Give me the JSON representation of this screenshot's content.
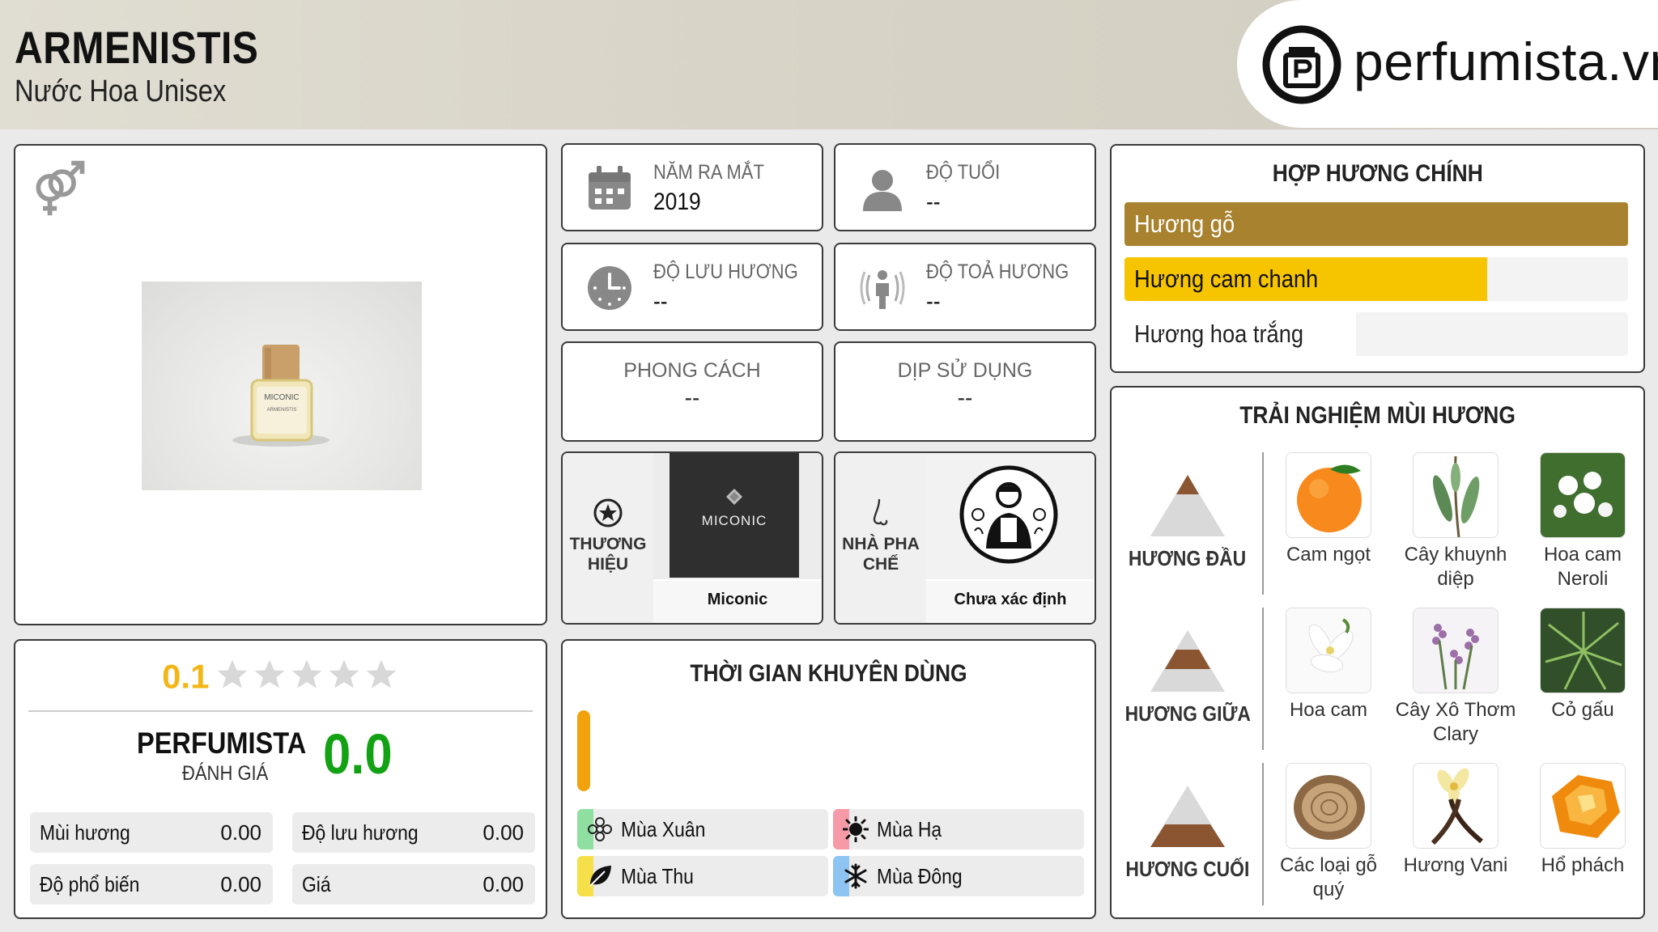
{
  "header": {
    "title": "ARMENISTIS",
    "subtitle": "Nước Hoa Unisex",
    "logo_text": "perfumista.vn"
  },
  "product": {
    "bottle_brand": "MICONIC",
    "bottle_name": "ARMENISTIS"
  },
  "info": {
    "release_year": {
      "label": "NĂM RA MẮT",
      "value": "2019"
    },
    "age": {
      "label": "ĐỘ TUỔI",
      "value": "--"
    },
    "longevity": {
      "label": "ĐỘ LƯU HƯƠNG",
      "value": "--"
    },
    "sillage": {
      "label": "ĐỘ TOẢ HƯƠNG",
      "value": "--"
    },
    "style": {
      "label": "PHONG CÁCH",
      "value": "--"
    },
    "occasion": {
      "label": "DỊP SỬ DỤNG",
      "value": "--"
    }
  },
  "brand": {
    "label": "THƯƠNG HIỆU",
    "logo_text": "MICONIC",
    "name": "Miconic"
  },
  "perfumer": {
    "label": "NHÀ PHA CHẾ",
    "name": "Chưa xác định"
  },
  "accords": {
    "title": "HỢP HƯƠNG CHÍNH",
    "items": [
      {
        "label": "Hương gỗ",
        "color": "#a8822e",
        "text_color": "#ffffff",
        "level": 1.0
      },
      {
        "label": "Hương cam chanh",
        "color": "#f7c500",
        "text_color": "#111111",
        "level": 0.72
      },
      {
        "label": "Hương hoa trắng",
        "color": "#ffffff",
        "text_color": "#222222",
        "level": 0.46
      }
    ]
  },
  "notes": {
    "title": "TRẢI NGHIỆM MÙI HƯƠNG",
    "tiers": [
      {
        "label": "HƯƠNG ĐẦU",
        "items": [
          "Cam ngọt",
          "Cây khuynh diệp",
          "Hoa cam Neroli"
        ]
      },
      {
        "label": "HƯƠNG GIỮA",
        "items": [
          "Hoa cam",
          "Cây Xô Thơm Clary",
          "Cỏ gấu"
        ]
      },
      {
        "label": "HƯƠNG CUỐI",
        "items": [
          "Các loại gỗ quý",
          "Hương Vani",
          "Hổ phách"
        ]
      }
    ]
  },
  "rating": {
    "value": "0.1",
    "stars": 0,
    "brand": "PERFUMISTA",
    "sub": "ĐÁNH GIÁ",
    "score": "0.0",
    "metrics": [
      {
        "label": "Mùi hương",
        "value": "0.00"
      },
      {
        "label": "Độ lưu hương",
        "value": "0.00"
      },
      {
        "label": "Độ phổ biến",
        "value": "0.00"
      },
      {
        "label": "Giá",
        "value": "0.00"
      }
    ]
  },
  "seasons": {
    "title": "THỜI GIAN KHUYÊN DÙNG",
    "items": [
      {
        "label": "Mùa Xuân",
        "color": "#8fe0a0"
      },
      {
        "label": "Mùa Hạ",
        "color": "#f79aa8"
      },
      {
        "label": "Mùa Thu",
        "color": "#f5e04a"
      },
      {
        "label": "Mùa Đông",
        "color": "#8ec4f2"
      }
    ]
  }
}
